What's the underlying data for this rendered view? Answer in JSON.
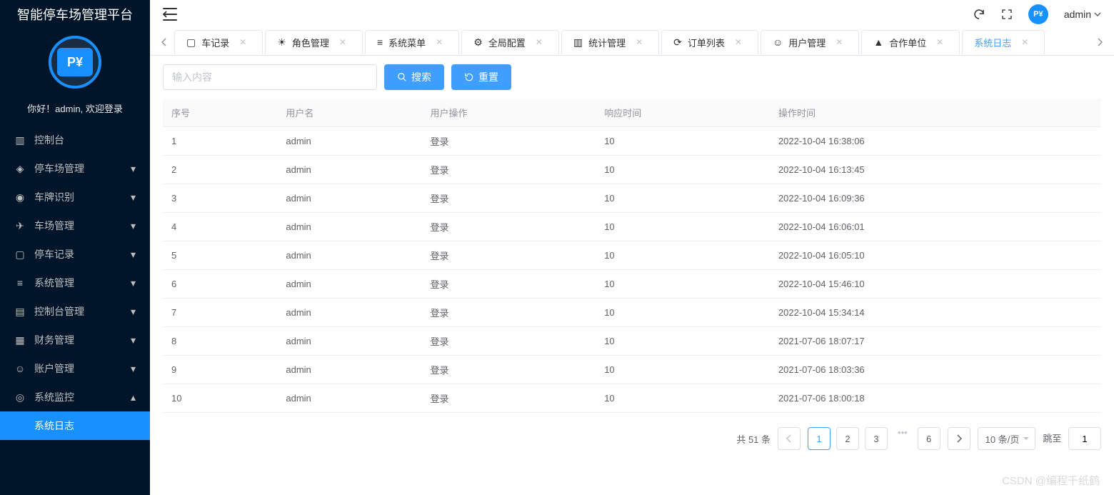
{
  "app_title": "智能停车场管理平台",
  "welcome_prefix": "你好！",
  "welcome_user": "admin",
  "welcome_suffix": ", 欢迎登录",
  "logo_text": "P¥",
  "header": {
    "username": "admin"
  },
  "sidebar": {
    "items": [
      {
        "label": "控制台",
        "expandable": false
      },
      {
        "label": "停车场管理",
        "expandable": true
      },
      {
        "label": "车牌识别",
        "expandable": true
      },
      {
        "label": "车场管理",
        "expandable": true
      },
      {
        "label": "停车记录",
        "expandable": true
      },
      {
        "label": "系统管理",
        "expandable": true
      },
      {
        "label": "控制台管理",
        "expandable": true
      },
      {
        "label": "财务管理",
        "expandable": true
      },
      {
        "label": "账户管理",
        "expandable": true
      },
      {
        "label": "系统监控",
        "expandable": true,
        "open": true
      }
    ],
    "active_submenu": "系统日志"
  },
  "tabs": [
    {
      "label": "车记录",
      "active": false
    },
    {
      "label": "角色管理",
      "active": false
    },
    {
      "label": "系统菜单",
      "active": false
    },
    {
      "label": "全局配置",
      "active": false
    },
    {
      "label": "统计管理",
      "active": false
    },
    {
      "label": "订单列表",
      "active": false
    },
    {
      "label": "用户管理",
      "active": false
    },
    {
      "label": "合作单位",
      "active": false
    },
    {
      "label": "系统日志",
      "active": true
    }
  ],
  "search": {
    "placeholder": "输入内容",
    "search_btn": "搜索",
    "reset_btn": "重置"
  },
  "table": {
    "headers": [
      "序号",
      "用户名",
      "用户操作",
      "响应时间",
      "操作时间"
    ],
    "rows": [
      {
        "idx": "1",
        "user": "admin",
        "op": "登录",
        "rt": "10",
        "time": "2022-10-04 16:38:06"
      },
      {
        "idx": "2",
        "user": "admin",
        "op": "登录",
        "rt": "10",
        "time": "2022-10-04 16:13:45"
      },
      {
        "idx": "3",
        "user": "admin",
        "op": "登录",
        "rt": "10",
        "time": "2022-10-04 16:09:36"
      },
      {
        "idx": "4",
        "user": "admin",
        "op": "登录",
        "rt": "10",
        "time": "2022-10-04 16:06:01"
      },
      {
        "idx": "5",
        "user": "admin",
        "op": "登录",
        "rt": "10",
        "time": "2022-10-04 16:05:10"
      },
      {
        "idx": "6",
        "user": "admin",
        "op": "登录",
        "rt": "10",
        "time": "2022-10-04 15:46:10"
      },
      {
        "idx": "7",
        "user": "admin",
        "op": "登录",
        "rt": "10",
        "time": "2022-10-04 15:34:14"
      },
      {
        "idx": "8",
        "user": "admin",
        "op": "登录",
        "rt": "10",
        "time": "2021-07-06 18:07:17"
      },
      {
        "idx": "9",
        "user": "admin",
        "op": "登录",
        "rt": "10",
        "time": "2021-07-06 18:03:36"
      },
      {
        "idx": "10",
        "user": "admin",
        "op": "登录",
        "rt": "10",
        "time": "2021-07-06 18:00:18"
      }
    ]
  },
  "pagination": {
    "total_text": "共 51 条",
    "pages": [
      "1",
      "2",
      "3",
      "6"
    ],
    "current": "1",
    "size_label": "10 条/页",
    "jump_label": "跳至",
    "jump_value": "1"
  },
  "watermark": "CSDN @编程千纸鹤"
}
